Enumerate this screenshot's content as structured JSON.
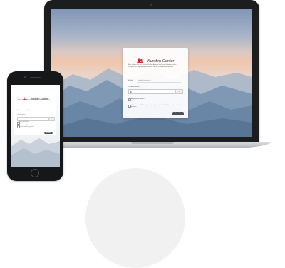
{
  "brand": {
    "title": "Kunden-Center",
    "accent_color": "#d9242a",
    "icon": "users-icon"
  },
  "login": {
    "intro": "Bitte melden Sie sich mit Ihrer E-Mail-Adresse und Ihrem Kunden-Center-Passwort an. Zugangsdaten erhalten Sie von Ihrem Ansprechpartner.",
    "email_label": "E-Mail",
    "email_value": "kunde@beispiel.de",
    "password_label": "Passwort wählen",
    "password_placeholder": "Passwort eingeben",
    "help_label": "?",
    "remember_label": "Angemeldet bleiben",
    "terms_text": "Ich stimme den Nutzungsbedingungen zu und habe die Datenschutzerklärung gelesen.",
    "terms_link": "Nutzungsbedingungen",
    "submit_label": "Anmelden"
  }
}
